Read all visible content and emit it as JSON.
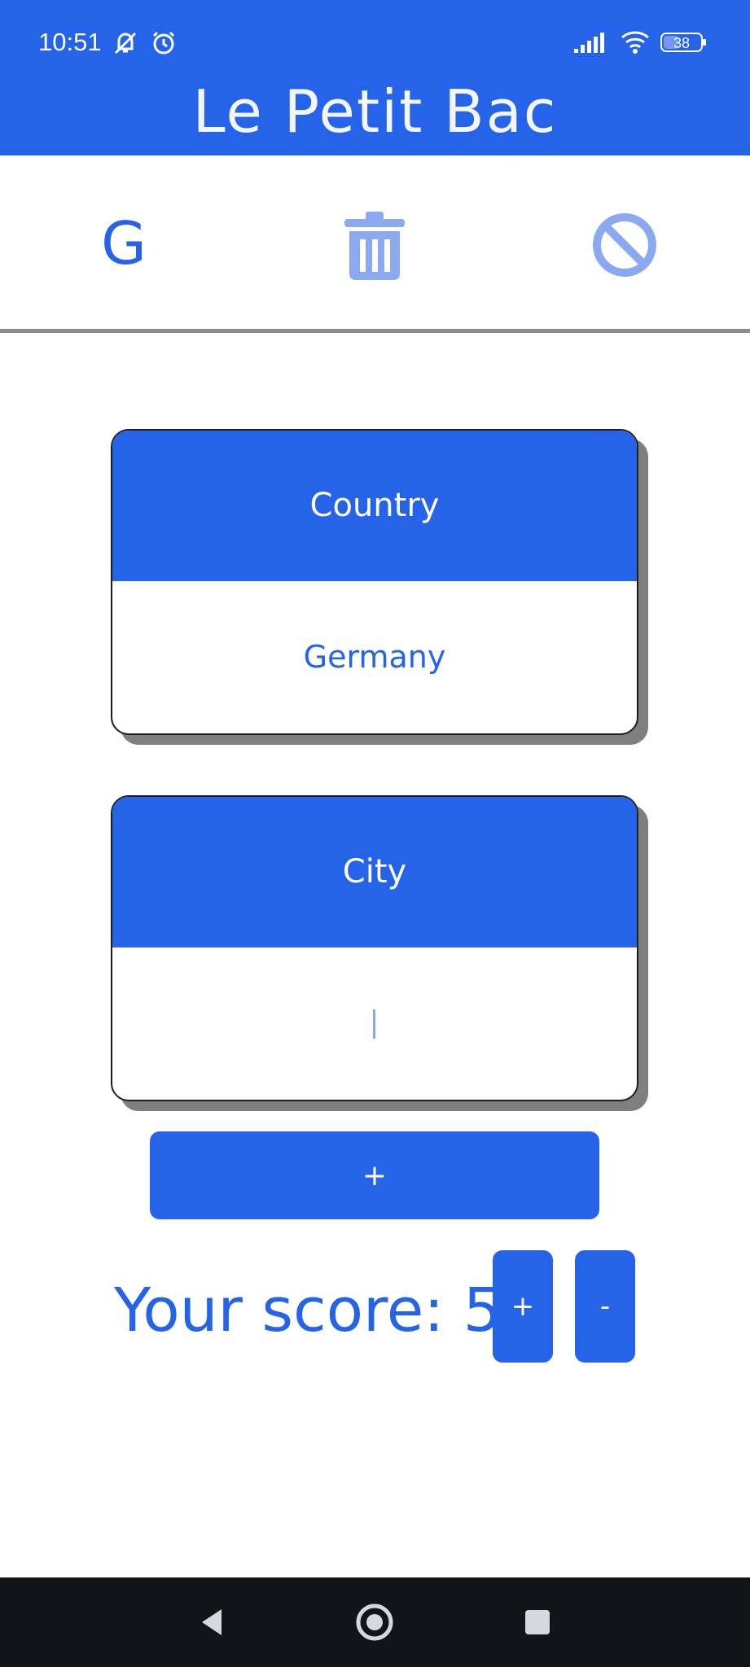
{
  "status_bar": {
    "time": "10:51",
    "battery": "38",
    "icons": [
      "mute-icon",
      "alarm-icon",
      "signal-icon",
      "wifi-icon",
      "battery-icon"
    ]
  },
  "app": {
    "title": "Le Petit Bac"
  },
  "toolbar": {
    "letter": "G",
    "icons": [
      "trash-icon",
      "block-icon"
    ]
  },
  "cards": [
    {
      "category": "Country",
      "answer": "Germany"
    },
    {
      "category": "City",
      "answer": ""
    }
  ],
  "add_button": {
    "label": "+"
  },
  "score": {
    "label": "Your score: 5",
    "increment_label": "+",
    "decrement_label": "-"
  },
  "nav": {
    "icons": [
      "back-icon",
      "home-icon",
      "recents-icon"
    ]
  },
  "colors": {
    "primary": "#2563e8",
    "light_icon": "#8aa9f0",
    "nav_bar": "#12141c",
    "divider": "#8b8b8b"
  }
}
